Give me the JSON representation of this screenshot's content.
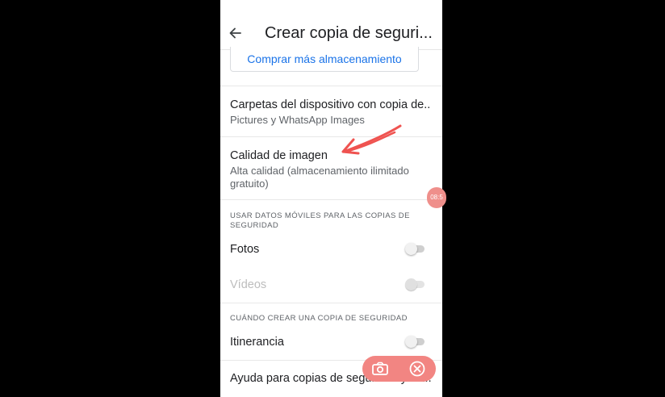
{
  "header": {
    "title": "Crear copia de seguri..."
  },
  "buy_button": {
    "label": "Comprar más almacenamiento"
  },
  "folders": {
    "title": "Carpetas del dispositivo con copia de..",
    "subtitle": "Pictures y WhatsApp Images"
  },
  "quality": {
    "title": "Calidad de imagen",
    "subtitle": "Alta calidad (almacenamiento ilimitado gratuito)"
  },
  "mobile_data": {
    "heading": "USAR DATOS MÓVILES PARA LAS COPIAS DE SEGURIDAD",
    "photos_label": "Fotos",
    "photos_enabled": false,
    "videos_label": "Vídeos",
    "videos_enabled": false
  },
  "when_backup": {
    "heading": "CUÁNDO CREAR UNA COPIA DE SEGURIDAD",
    "roaming_label": "Itinerancia",
    "roaming_enabled": false
  },
  "help": {
    "label": "Ayuda para copias de seguridad y sin..."
  },
  "overlay": {
    "time_text": "08:5",
    "camera_icon": "camera-icon",
    "stop_icon": "close-circle-icon",
    "record_color": "#f28582",
    "annotation_arrow_color": "#ef5350"
  }
}
